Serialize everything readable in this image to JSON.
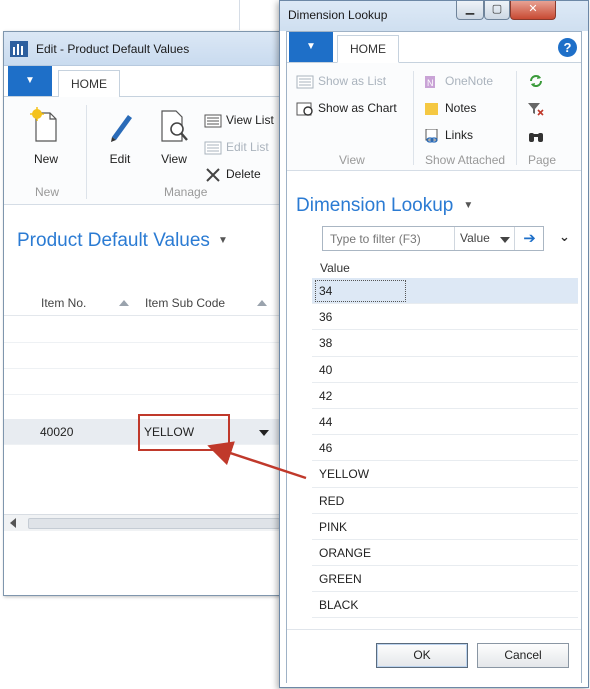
{
  "left_window": {
    "title": "Edit - Product Default Values",
    "tab_home": "HOME",
    "ribbon": {
      "new_label": "New",
      "group_new": "New",
      "edit_label": "Edit",
      "view_label": "View",
      "view_list": "View List",
      "edit_list": "Edit List",
      "delete": "Delete",
      "group_manage": "Manage"
    },
    "page_title": "Product Default Values",
    "columns": [
      "Item No.",
      "Item Sub Code"
    ],
    "row": {
      "item_no": "40020",
      "item_sub_code": "YELLOW"
    }
  },
  "right_window": {
    "title": "Dimension Lookup",
    "tab_home": "HOME",
    "help": "?",
    "ribbon": {
      "show_as_list": "Show as List",
      "show_as_chart": "Show as Chart",
      "group_view": "View",
      "onenote": "OneNote",
      "notes": "Notes",
      "links": "Links",
      "group_show_attached": "Show Attached",
      "group_page": "Page"
    },
    "page_title": "Dimension Lookup",
    "filter_placeholder": "Type to filter (F3)",
    "filter_field": "Value",
    "column_value": "Value",
    "values": [
      "34",
      "36",
      "38",
      "40",
      "42",
      "44",
      "46",
      "YELLOW",
      "RED",
      "PINK",
      "ORANGE",
      "GREEN",
      "BLACK"
    ],
    "selected_value": "34",
    "ok_label": "OK",
    "cancel_label": "Cancel"
  },
  "colors": {
    "accent_blue": "#1e6fc8",
    "title_blue": "#2b7bd3",
    "highlight_red": "#c0392b"
  }
}
